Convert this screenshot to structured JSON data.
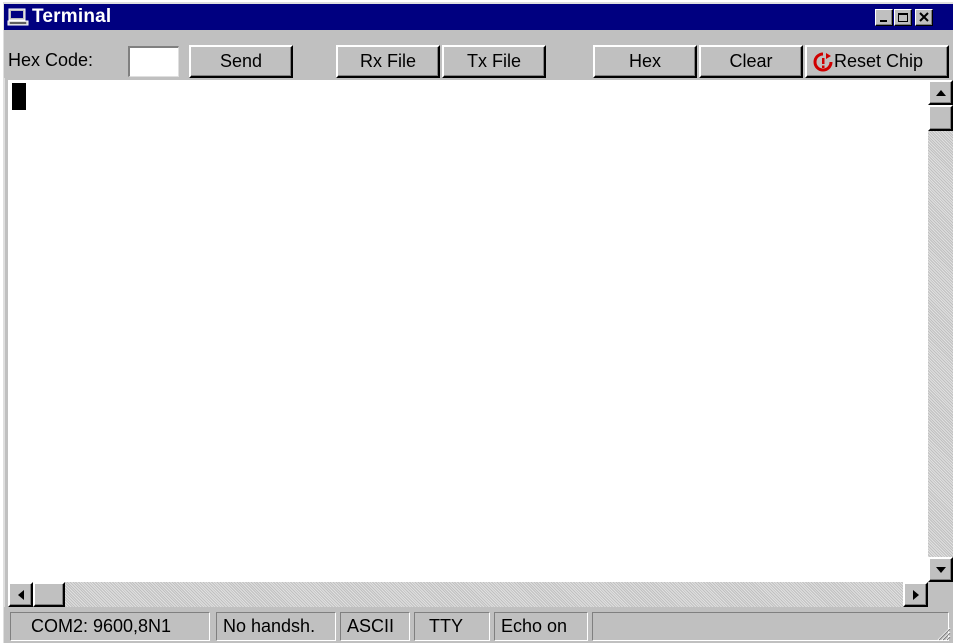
{
  "window": {
    "title": "Terminal"
  },
  "toolbar": {
    "hex_label": "Hex Code:",
    "hex_value": "",
    "buttons": {
      "send": "Send",
      "rx_file": "Rx File",
      "tx_file": "Tx File",
      "hex": "Hex",
      "clear": "Clear",
      "reset_chip": "Reset Chip"
    }
  },
  "statusbar": {
    "port": "COM2: 9600,8N1",
    "handshake": "No handsh.",
    "mode": "ASCII",
    "emulation": "TTY",
    "echo": "Echo on",
    "extra": ""
  },
  "colors": {
    "titlebar": "#000080",
    "face": "#c0c0c0",
    "reset_icon": "#d00000"
  },
  "icons": {
    "title": "terminal-computer-icon",
    "minimize": "minimize-icon",
    "maximize": "maximize-icon",
    "close": "close-icon",
    "reset": "reset-chip-icon"
  }
}
